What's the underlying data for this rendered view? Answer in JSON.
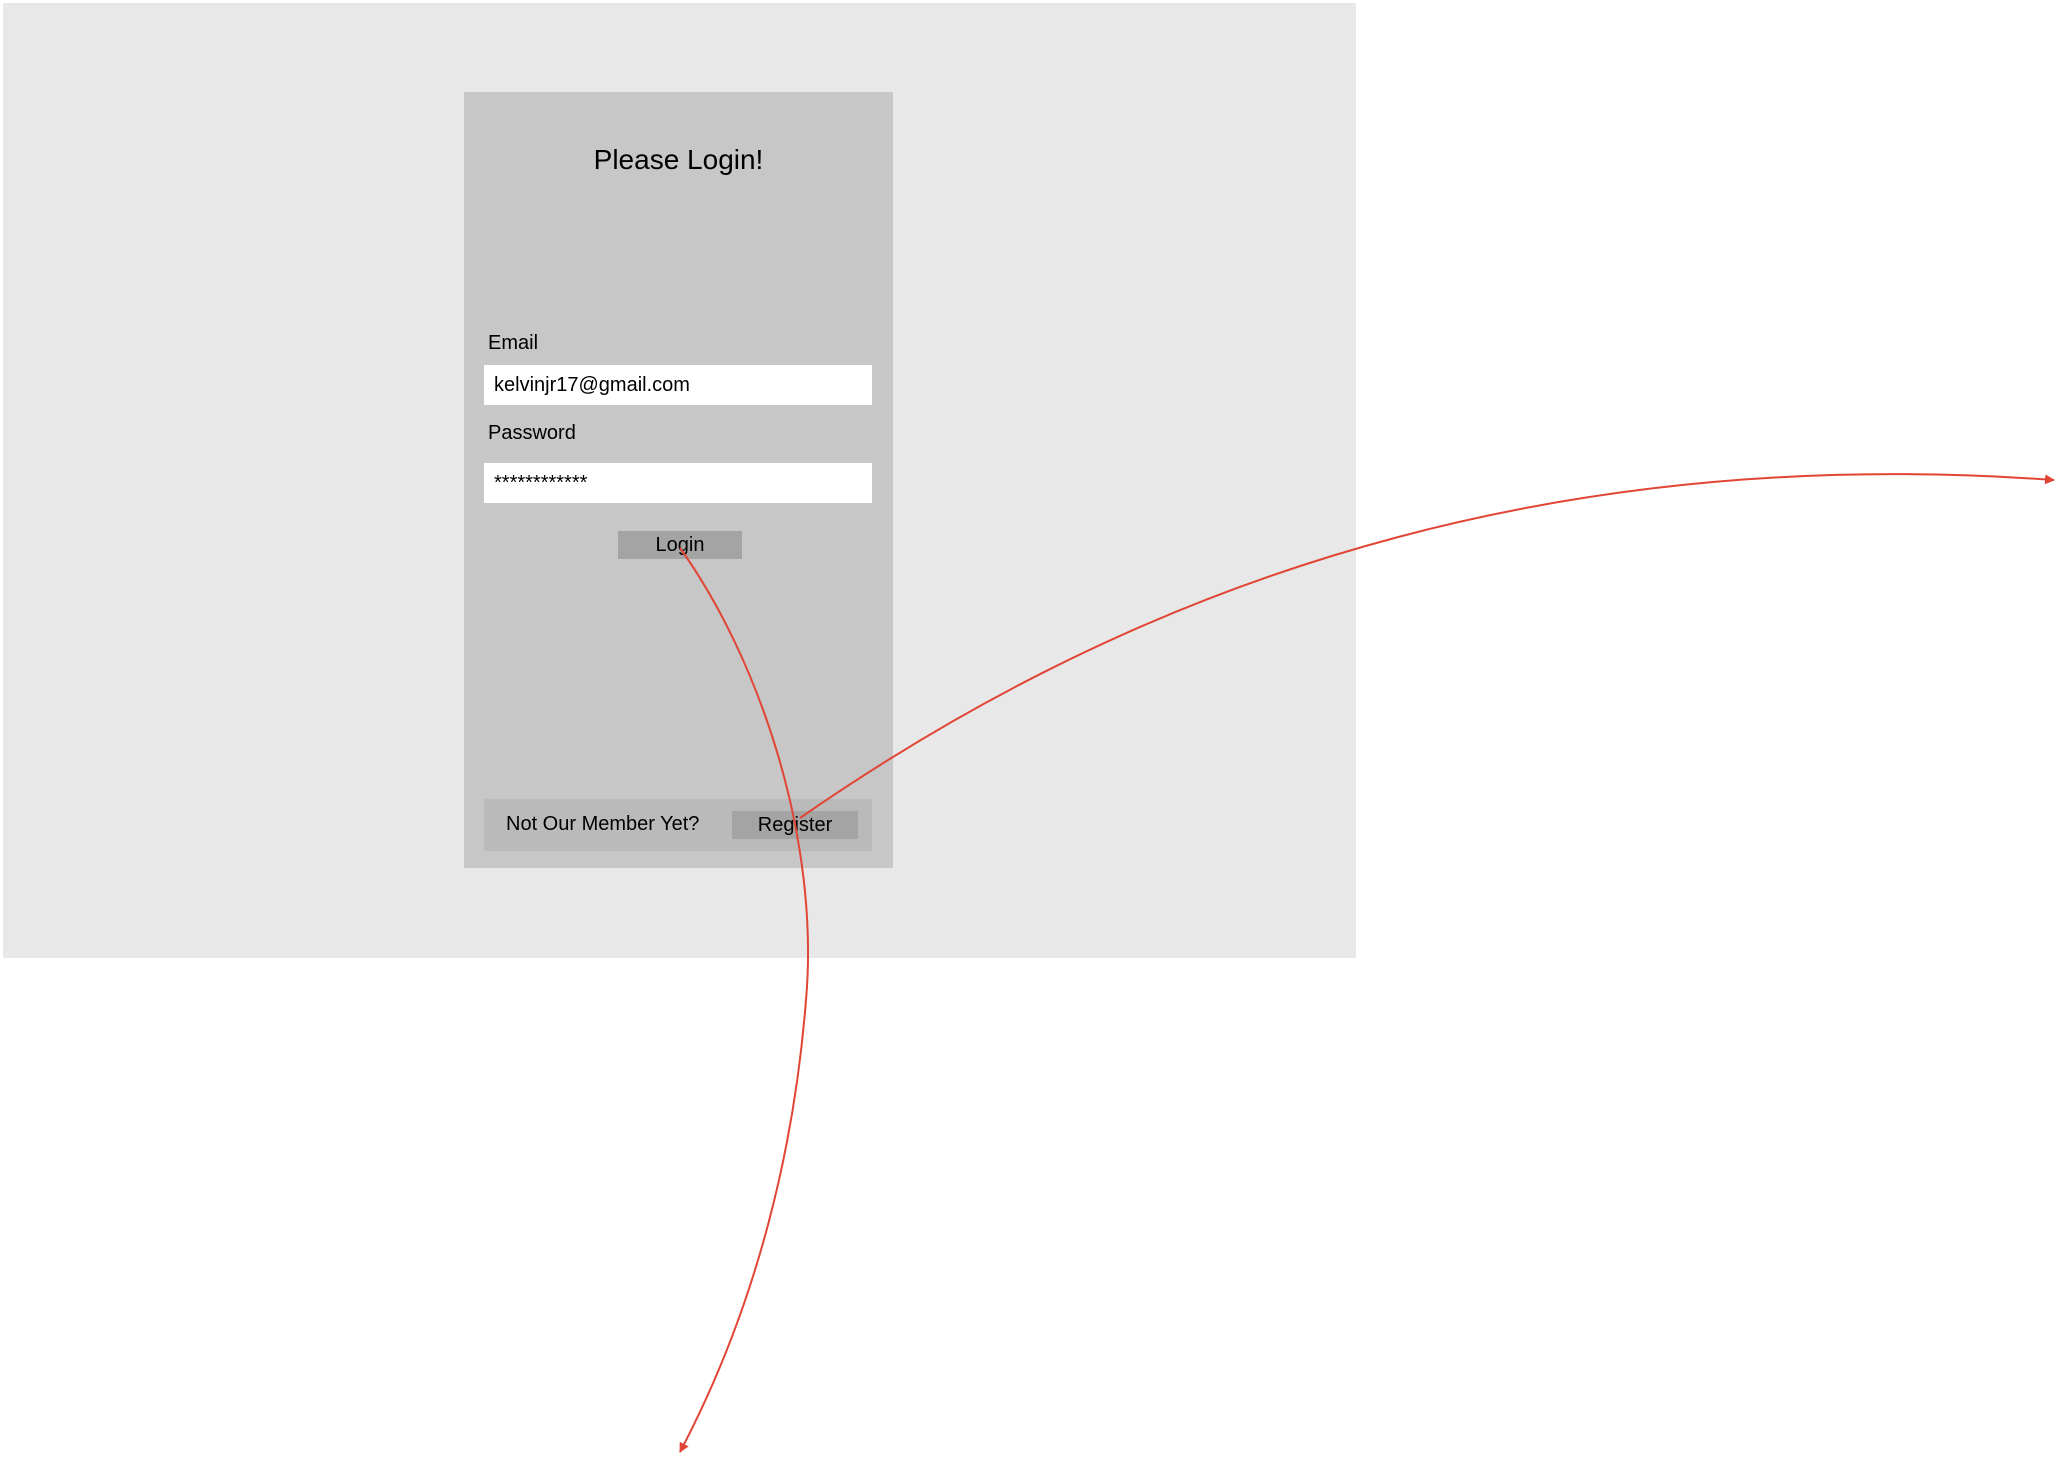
{
  "login_form": {
    "title": "Please Login!",
    "email_label": "Email",
    "email_value": "kelvinjr17@gmail.com",
    "password_label": "Password",
    "password_value": "************",
    "login_button": "Login"
  },
  "footer": {
    "prompt": "Not Our Member Yet?",
    "register_button": "Register"
  },
  "colors": {
    "page_background": "#e8e8e8",
    "card_background": "#c7c7c7",
    "footer_background": "#bababa",
    "button_background": "#a4a4a4",
    "arrow": "#e04535"
  }
}
